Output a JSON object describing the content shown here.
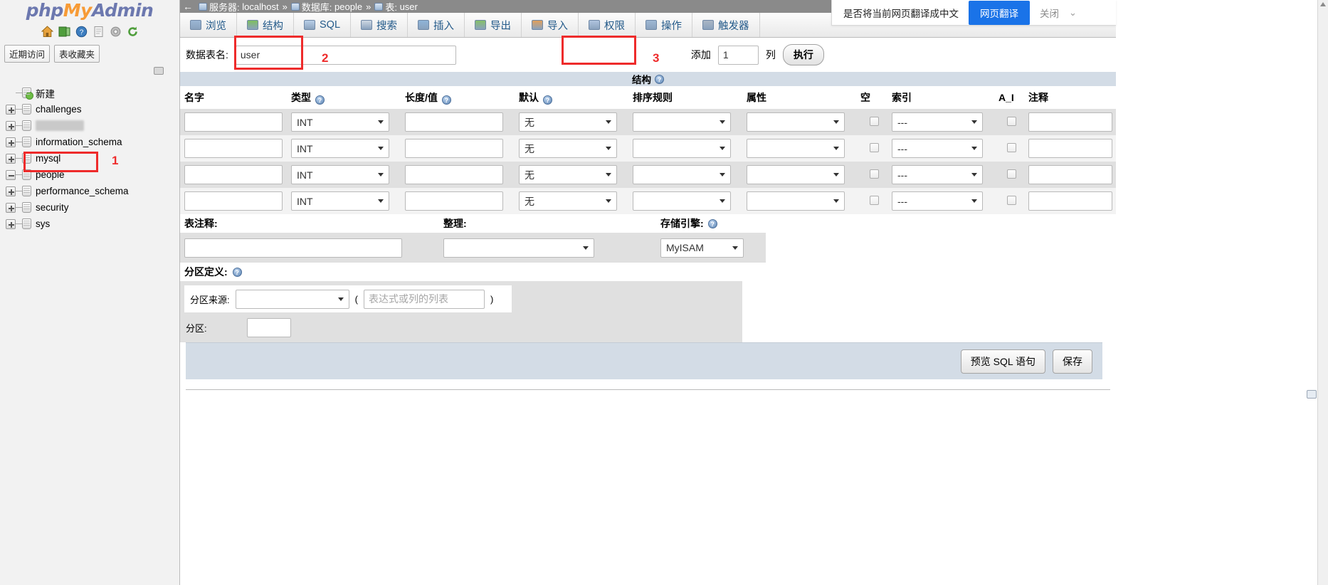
{
  "brand": {
    "php": "php",
    "my": "My",
    "admin": "Admin"
  },
  "sidebar": {
    "icons": [
      "home-icon",
      "logout-icon",
      "help-icon",
      "docs-icon",
      "settings-icon",
      "reload-icon"
    ],
    "quick_links": [
      {
        "label": "近期访问",
        "name": "recent-tables-button"
      },
      {
        "label": "表收藏夹",
        "name": "favorite-tables-button"
      }
    ],
    "tree": [
      {
        "label": "新建",
        "toggle": "none",
        "icon": "db-new-icon",
        "selected": false,
        "blurred": false
      },
      {
        "label": "challenges",
        "toggle": "plus",
        "icon": "db-icon",
        "selected": false,
        "blurred": false
      },
      {
        "label": "",
        "toggle": "plus",
        "icon": "db-icon",
        "selected": false,
        "blurred": true
      },
      {
        "label": "information_schema",
        "toggle": "plus",
        "icon": "db-icon",
        "selected": false,
        "blurred": false
      },
      {
        "label": "mysql",
        "toggle": "plus",
        "icon": "db-icon",
        "selected": false,
        "blurred": false
      },
      {
        "label": "people",
        "toggle": "minus",
        "icon": "db-icon",
        "selected": true,
        "blurred": false
      },
      {
        "label": "performance_schema",
        "toggle": "plus",
        "icon": "db-icon",
        "selected": false,
        "blurred": false
      },
      {
        "label": "security",
        "toggle": "plus",
        "icon": "db-icon",
        "selected": false,
        "blurred": false
      },
      {
        "label": "sys",
        "toggle": "plus",
        "icon": "db-icon",
        "selected": false,
        "blurred": false
      }
    ]
  },
  "breadcrumb": {
    "back": "←",
    "server_label": "服务器:",
    "server_value": "localhost",
    "sep": "»",
    "db_label": "数据库:",
    "db_value": "people",
    "table_label": "表:",
    "table_value": "user"
  },
  "tabs": [
    {
      "label": "浏览",
      "icon": "browse-icon",
      "active": false
    },
    {
      "label": "结构",
      "icon": "structure-icon",
      "active": false
    },
    {
      "label": "SQL",
      "icon": "sql-icon",
      "active": false
    },
    {
      "label": "搜索",
      "icon": "search-icon",
      "active": false
    },
    {
      "label": "插入",
      "icon": "insert-icon",
      "active": false
    },
    {
      "label": "导出",
      "icon": "export-icon",
      "active": false
    },
    {
      "label": "导入",
      "icon": "import-icon",
      "active": false
    },
    {
      "label": "权限",
      "icon": "privileges-icon",
      "active": false
    },
    {
      "label": "操作",
      "icon": "operations-icon",
      "active": false
    },
    {
      "label": "触发器",
      "icon": "triggers-icon",
      "active": false
    }
  ],
  "translate": {
    "question": "是否将当前网页翻译成中文",
    "translate_label": "网页翻译",
    "close_label": "关闭",
    "chevron": "⌄",
    "accent": "#1a73e8"
  },
  "form": {
    "table_name_label": "数据表名:",
    "table_name_value": "user",
    "table_name_placeholder": "",
    "add_label": "添加",
    "add_value": "1",
    "columns_label": "列",
    "go_label": "执行"
  },
  "structure": {
    "section_title": "结构",
    "headers": [
      {
        "label": "名字",
        "help": false
      },
      {
        "label": "类型",
        "help": true
      },
      {
        "label": "长度/值",
        "help": true
      },
      {
        "label": "默认",
        "help": true
      },
      {
        "label": "排序规则",
        "help": false
      },
      {
        "label": "属性",
        "help": false
      },
      {
        "label": "空",
        "help": false
      },
      {
        "label": "索引",
        "help": false
      },
      {
        "label": "A_I",
        "help": false
      },
      {
        "label": "注释",
        "help": false
      }
    ],
    "rows": [
      {
        "name": "",
        "type": "INT",
        "length": "",
        "default": "无",
        "collation": "",
        "attributes": "",
        "null": false,
        "index": "---",
        "ai": false,
        "comment": ""
      },
      {
        "name": "",
        "type": "INT",
        "length": "",
        "default": "无",
        "collation": "",
        "attributes": "",
        "null": false,
        "index": "---",
        "ai": false,
        "comment": ""
      },
      {
        "name": "",
        "type": "INT",
        "length": "",
        "default": "无",
        "collation": "",
        "attributes": "",
        "null": false,
        "index": "---",
        "ai": false,
        "comment": ""
      },
      {
        "name": "",
        "type": "INT",
        "length": "",
        "default": "无",
        "collation": "",
        "attributes": "",
        "null": false,
        "index": "---",
        "ai": false,
        "comment": ""
      }
    ]
  },
  "table_options": {
    "comment_label": "表注释:",
    "comment_value": "",
    "collation_label": "整理:",
    "collation_value": "",
    "engine_label": "存储引擎:",
    "engine_value": "MyISAM"
  },
  "partition": {
    "title": "分区定义:",
    "source_label": "分区来源:",
    "source_value": "",
    "open_paren": "(",
    "expr_placeholder": "表达式或列的列表",
    "expr_value": "",
    "close_paren": ")",
    "partitions_label": "分区:",
    "partitions_value": ""
  },
  "actions": {
    "preview_sql_label": "预览 SQL 语句",
    "save_label": "保存"
  },
  "annotations": [
    {
      "num": "1",
      "target": "sidebar-item-people"
    },
    {
      "num": "2",
      "target": "table-name-input"
    },
    {
      "num": "3",
      "target": "go-button"
    }
  ]
}
